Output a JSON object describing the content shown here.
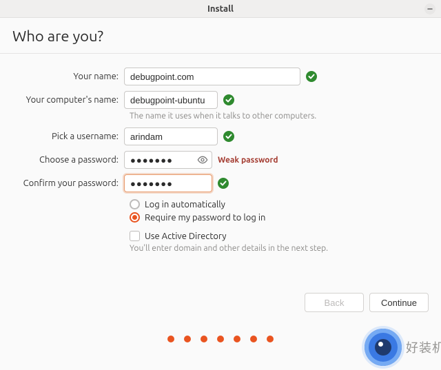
{
  "window": {
    "title": "Install"
  },
  "page": {
    "title": "Who are you?"
  },
  "form": {
    "name_label": "Your name:",
    "name_value": "debugpoint.com",
    "computer_label": "Your computer's name:",
    "computer_value": "debugpoint-ubuntu",
    "computer_hint": "The name it uses when it talks to other computers.",
    "username_label": "Pick a username:",
    "username_value": "arindam",
    "password_label": "Choose a password:",
    "password_value": "●●●●●●●",
    "password_strength": "Weak password",
    "confirm_label": "Confirm your password:",
    "confirm_value": "●●●●●●●"
  },
  "options": {
    "auto_login": "Log in automatically",
    "require_pwd": "Require my password to log in",
    "active_directory": "Use Active Directory",
    "ad_hint": "You'll enter domain and other details in the next step."
  },
  "footer": {
    "back": "Back",
    "continue": "Continue"
  },
  "promo": {
    "text": "好装机"
  }
}
